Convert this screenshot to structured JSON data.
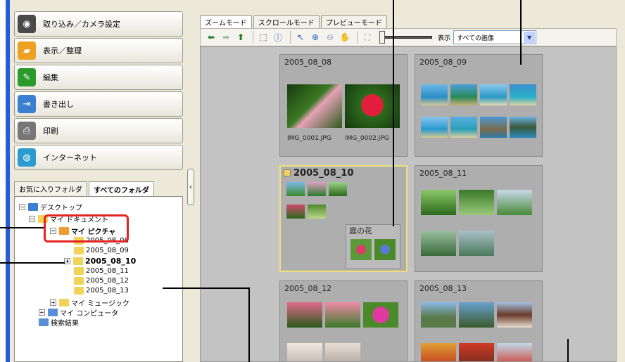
{
  "nav_buttons": [
    {
      "label": "取り込み／カメラ設定",
      "icon": "camera-icon",
      "color": "#4a4a4a"
    },
    {
      "label": "表示／整理",
      "icon": "folder-icon",
      "color": "#f0a020"
    },
    {
      "label": "編集",
      "icon": "edit-icon",
      "color": "#2a9a2a"
    },
    {
      "label": "書き出し",
      "icon": "export-icon",
      "color": "#3a7fd0"
    },
    {
      "label": "印刷",
      "icon": "printer-icon",
      "color": "#666666"
    },
    {
      "label": "インターネット",
      "icon": "globe-icon",
      "color": "#2a9ad0"
    }
  ],
  "left_tabs": {
    "favorites": "お気に入りフォルダ",
    "all": "すべてのフォルダ"
  },
  "tree": {
    "desktop": "デスクトップ",
    "mydocs": "マイ ドキュメント",
    "mypictures": "マイ ピクチャ",
    "f1": "2005_08_08",
    "f2": "2005_08_09",
    "f3": "2005_08_10",
    "f4": "2005_08_11",
    "f5": "2005_08_12",
    "f6": "2005_08_13",
    "mymusic": "マイ ミュージック",
    "mycomputer": "マイ コンピュータ",
    "search": "検索結果"
  },
  "right_tabs": {
    "zoom": "ズームモード",
    "scroll": "スクロールモード",
    "preview": "プレビューモード"
  },
  "toolbar": {
    "display_label": "表示",
    "select_value": "すべての画像"
  },
  "panels": {
    "p1": {
      "title": "2005_08_08",
      "file1": "IMG_0001.JPG",
      "file2": "IMG_0002.JPG"
    },
    "p2": {
      "title": "2005_08_09"
    },
    "p3": {
      "title": "2005_08_10",
      "subfolder": "庭の花"
    },
    "p4": {
      "title": "2005_08_11"
    },
    "p5": {
      "title": "2005_08_12"
    },
    "p6": {
      "title": "2005_08_13"
    }
  },
  "colors": {
    "selected_border": "#f0e07a",
    "callout_red": "#e52222",
    "panel_bg": "#aeaeae",
    "grid_bg": "#c3c3c3"
  }
}
